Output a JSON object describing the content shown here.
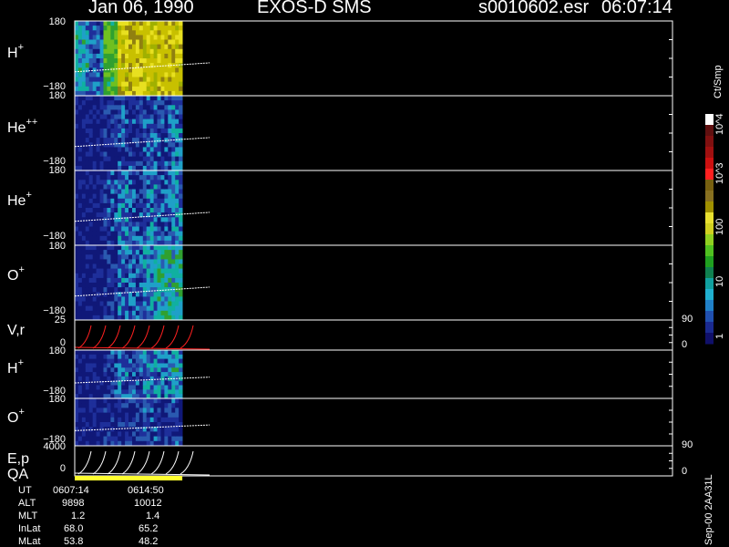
{
  "header": {
    "date": "Jan 06, 1990",
    "instrument": "EXOS-D SMS",
    "file": "s0010602.esr",
    "time": "06:07:14"
  },
  "colorbar": {
    "unit_label": "Ct/Smp",
    "tick_labels": [
      "1",
      "10",
      "100",
      "10^3",
      "10^4"
    ]
  },
  "panels": {
    "hplus": {
      "label": "H",
      "sup": "+",
      "top_tick": "180",
      "bottom_tick": "−180"
    },
    "hepp": {
      "label": "He",
      "sup": "++",
      "top_tick": "180",
      "bottom_tick": "−180"
    },
    "heplus": {
      "label": "He",
      "sup": "+",
      "top_tick": "180",
      "bottom_tick": "−180"
    },
    "oplus": {
      "label": "O",
      "sup": "+",
      "top_tick": "180",
      "bottom_tick": "−180"
    },
    "vr": {
      "label": "V,r",
      "top_tick": "25",
      "bottom_tick": "0",
      "right_top": "90",
      "right_bottom": "0"
    },
    "hplus2": {
      "label": "H",
      "sup": "+",
      "top_tick": "180",
      "bottom_tick": "−180"
    },
    "oplus2": {
      "label": "O",
      "sup": "+",
      "top_tick": "180",
      "bottom_tick": "−180"
    },
    "ep": {
      "label": "E,p",
      "top_tick": "4000",
      "bottom_tick": "0",
      "right_top": "90",
      "right_bottom": "0"
    },
    "qa": {
      "label": "QA"
    }
  },
  "info_table": {
    "rows": [
      {
        "name": "UT",
        "v1": "0607:14",
        "v2": "0614:50"
      },
      {
        "name": "ALT",
        "v1": "9898",
        "v2": "10012"
      },
      {
        "name": "MLT",
        "v1": "1.2",
        "v2": "1.4"
      },
      {
        "name": "InLat",
        "v1": "68.0",
        "v2": "65.2"
      },
      {
        "name": "MLat",
        "v1": "53.8",
        "v2": "48.2"
      }
    ]
  },
  "footer_id": "Sep-00 2AA31L",
  "colors": {
    "background": "#000000",
    "axis": "#ffffff",
    "trace": "#ff2020",
    "qa_bar": "#ffff30"
  },
  "chart_data": {
    "type": "heatmap",
    "colorbar_scale": "log",
    "colorbar_range": [
      1,
      10000
    ],
    "x_range_ut": [
      "0607:14",
      "0614:50"
    ],
    "y_range_deg": [
      -180,
      180
    ],
    "data_coverage_fraction": 0.18,
    "note_bands": [
      {
        "panel": "H+",
        "intensity_levels": [
          1.2,
          0.8,
          2.0,
          3.4,
          3.6,
          3.2,
          3.5,
          3.4
        ]
      },
      {
        "panel": "He++",
        "intensity_levels": [
          0.3,
          0.3,
          0.5,
          0.7,
          0.6,
          0.8,
          0.7,
          0.9
        ]
      },
      {
        "panel": "He+",
        "intensity_levels": [
          0.3,
          0.3,
          0.6,
          1.0,
          0.7,
          0.9,
          0.8,
          1.0
        ]
      },
      {
        "panel": "O+",
        "intensity_levels": [
          0.3,
          0.3,
          0.5,
          0.9,
          0.8,
          1.1,
          1.3,
          1.4
        ]
      },
      {
        "panel": "H+ (2)",
        "intensity_levels": [
          0.3,
          0.3,
          0.6,
          0.9,
          0.7,
          1.0,
          0.9,
          1.2
        ]
      },
      {
        "panel": "O+ (2)",
        "intensity_levels": [
          0.3,
          0.3,
          0.4,
          0.5,
          0.5,
          0.6,
          0.5,
          0.6
        ]
      }
    ]
  }
}
